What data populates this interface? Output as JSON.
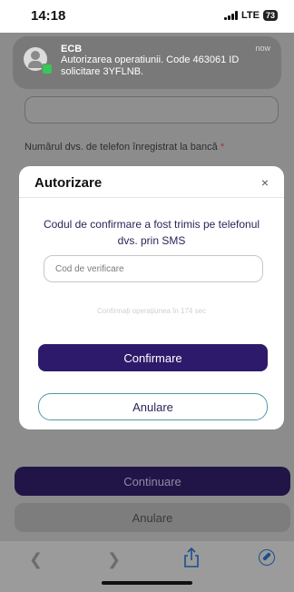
{
  "status_bar": {
    "time": "14:18",
    "network": "LTE",
    "battery": "73"
  },
  "notification": {
    "app": "ECB",
    "time": "now",
    "message": "Autorizarea operatiunii. Code 463061 ID solicitare 3YFLNB."
  },
  "background_page": {
    "phone_label": "Numărul dvs. de telefon înregistrat la bancă",
    "required_mark": "*",
    "continue_button": "Continuare",
    "cancel_button": "Anulare"
  },
  "modal": {
    "title": "Autorizare",
    "close_label": "×",
    "message": "Codul de confirmare a fost trimis pe telefonul dvs. prin SMS",
    "code_input": {
      "placeholder": "Cod de verificare",
      "value": ""
    },
    "countdown": "Confirmați operațiunea în 174 sec",
    "confirm_button": "Confirmare",
    "cancel_button": "Anulare"
  },
  "toolbar": {
    "icons": [
      "back-icon",
      "forward-icon",
      "share-icon",
      "compass-icon"
    ]
  },
  "colors": {
    "primary": "#2e1a6b",
    "accent_border": "#4f9aa6",
    "dim_overlay": "#8c8c8c"
  }
}
